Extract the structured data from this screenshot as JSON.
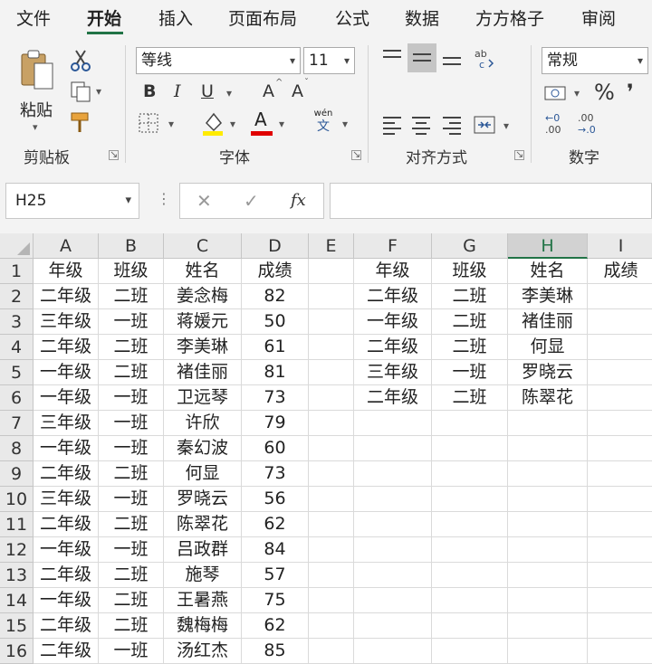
{
  "tabs": [
    "文件",
    "开始",
    "插入",
    "页面布局",
    "公式",
    "数据",
    "方方格子",
    "审阅"
  ],
  "active_tab": "开始",
  "accent_color": "#217346",
  "ribbon": {
    "clipboard": {
      "paste_label": "粘贴",
      "group_title": "剪贴板"
    },
    "font": {
      "font_name": "等线",
      "font_size": "11",
      "group_title": "字体",
      "bold": "B",
      "italic": "I",
      "underline": "U",
      "grow": "A",
      "shrink": "A",
      "font_color": "A",
      "phonetic_top": "wén",
      "phonetic_bottom": "文"
    },
    "alignment": {
      "group_title": "对齐方式"
    },
    "number": {
      "format": "常规",
      "percent": "%",
      "group_title": "数字"
    }
  },
  "formula_bar": {
    "name_box": "H25",
    "fx_label": "fx",
    "formula": ""
  },
  "columns": [
    "A",
    "B",
    "C",
    "D",
    "E",
    "F",
    "G",
    "H",
    "I"
  ],
  "selected_column": "H",
  "rows": [
    "1",
    "2",
    "3",
    "4",
    "5",
    "6",
    "7",
    "8",
    "9",
    "10",
    "11",
    "12",
    "13",
    "14",
    "15",
    "16"
  ],
  "cells": [
    [
      "年级",
      "班级",
      "姓名",
      "成绩",
      "",
      "年级",
      "班级",
      "姓名",
      "成绩"
    ],
    [
      "二年级",
      "二班",
      "姜念梅",
      "82",
      "",
      "二年级",
      "二班",
      "李美琳",
      ""
    ],
    [
      "三年级",
      "一班",
      "蒋媛元",
      "50",
      "",
      "一年级",
      "二班",
      "褚佳丽",
      ""
    ],
    [
      "二年级",
      "二班",
      "李美琳",
      "61",
      "",
      "二年级",
      "二班",
      "何显",
      ""
    ],
    [
      "一年级",
      "二班",
      "褚佳丽",
      "81",
      "",
      "三年级",
      "一班",
      "罗晓云",
      ""
    ],
    [
      "一年级",
      "一班",
      "卫远琴",
      "73",
      "",
      "二年级",
      "二班",
      "陈翠花",
      ""
    ],
    [
      "三年级",
      "一班",
      "许欣",
      "79",
      "",
      "",
      "",
      "",
      ""
    ],
    [
      "一年级",
      "一班",
      "秦幻波",
      "60",
      "",
      "",
      "",
      "",
      ""
    ],
    [
      "二年级",
      "二班",
      "何显",
      "73",
      "",
      "",
      "",
      "",
      ""
    ],
    [
      "三年级",
      "一班",
      "罗晓云",
      "56",
      "",
      "",
      "",
      "",
      ""
    ],
    [
      "二年级",
      "二班",
      "陈翠花",
      "62",
      "",
      "",
      "",
      "",
      ""
    ],
    [
      "一年级",
      "一班",
      "吕政群",
      "84",
      "",
      "",
      "",
      "",
      ""
    ],
    [
      "二年级",
      "二班",
      "施琴",
      "57",
      "",
      "",
      "",
      "",
      ""
    ],
    [
      "一年级",
      "二班",
      "王暑燕",
      "75",
      "",
      "",
      "",
      "",
      ""
    ],
    [
      "二年级",
      "二班",
      "魏梅梅",
      "62",
      "",
      "",
      "",
      "",
      ""
    ],
    [
      "二年级",
      "一班",
      "汤红杰",
      "85",
      "",
      "",
      "",
      "",
      ""
    ]
  ]
}
